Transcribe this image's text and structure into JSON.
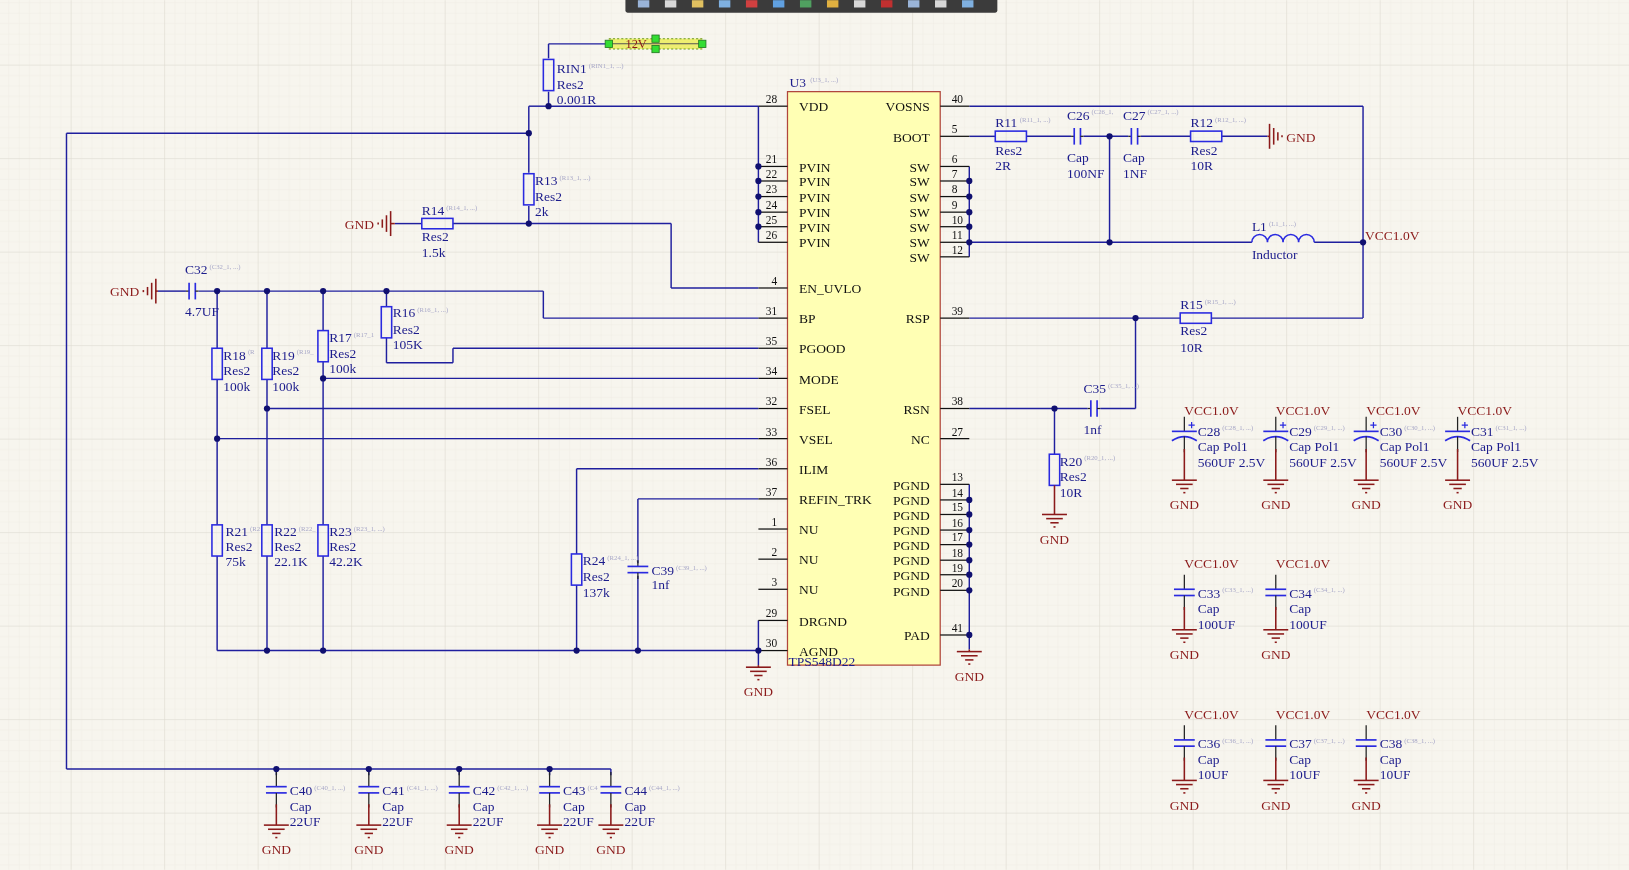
{
  "net_label": {
    "text": "12V",
    "selected": true
  },
  "chip": {
    "designator": "U3",
    "hint": "(U3_1, ...)",
    "part": "TPS548D22",
    "left_pins": [
      {
        "number": "28",
        "name": "VDD"
      },
      {
        "number": "21",
        "name": "PVIN"
      },
      {
        "number": "22",
        "name": "PVIN"
      },
      {
        "number": "23",
        "name": "PVIN"
      },
      {
        "number": "24",
        "name": "PVIN"
      },
      {
        "number": "25",
        "name": "PVIN"
      },
      {
        "number": "26",
        "name": "PVIN"
      },
      {
        "number": "4",
        "name": "EN_UVLO"
      },
      {
        "number": "31",
        "name": "BP"
      },
      {
        "number": "35",
        "name": "PGOOD"
      },
      {
        "number": "34",
        "name": "MODE"
      },
      {
        "number": "32",
        "name": "FSEL"
      },
      {
        "number": "33",
        "name": "VSEL"
      },
      {
        "number": "36",
        "name": "ILIM"
      },
      {
        "number": "37",
        "name": "REFIN_TRK"
      },
      {
        "number": "1",
        "name": "NU"
      },
      {
        "number": "2",
        "name": "NU"
      },
      {
        "number": "3",
        "name": "NU"
      },
      {
        "number": "29",
        "name": "DRGND"
      },
      {
        "number": "30",
        "name": "AGND"
      }
    ],
    "right_pins": [
      {
        "number": "40",
        "name": "VOSNS"
      },
      {
        "number": "5",
        "name": "BOOT"
      },
      {
        "number": "6",
        "name": "SW"
      },
      {
        "number": "7",
        "name": "SW"
      },
      {
        "number": "8",
        "name": "SW"
      },
      {
        "number": "9",
        "name": "SW"
      },
      {
        "number": "10",
        "name": "SW"
      },
      {
        "number": "11",
        "name": "SW"
      },
      {
        "number": "12",
        "name": "SW"
      },
      {
        "number": "39",
        "name": "RSP"
      },
      {
        "number": "38",
        "name": "RSN"
      },
      {
        "number": "27",
        "name": "NC"
      },
      {
        "number": "13",
        "name": "PGND"
      },
      {
        "number": "14",
        "name": "PGND"
      },
      {
        "number": "15",
        "name": "PGND"
      },
      {
        "number": "16",
        "name": "PGND"
      },
      {
        "number": "17",
        "name": "PGND"
      },
      {
        "number": "18",
        "name": "PGND"
      },
      {
        "number": "19",
        "name": "PGND"
      },
      {
        "number": "20",
        "name": "PGND"
      },
      {
        "number": "41",
        "name": "PAD"
      }
    ]
  },
  "components": [
    {
      "kind": "resistor",
      "designator": "RIN1",
      "hint": "(RIN1_1, ...)",
      "comment": "Res2",
      "value": "0.001R"
    },
    {
      "kind": "resistor",
      "designator": "R11",
      "hint": "(R11_1, ...)",
      "comment": "Res2",
      "value": "2R"
    },
    {
      "kind": "capacitor",
      "designator": "C26",
      "hint": "(C26_1,",
      "comment": "Cap",
      "value": "100NF"
    },
    {
      "kind": "capacitor",
      "designator": "C27",
      "hint": "(C27_1, ...)",
      "comment": "Cap",
      "value": "1NF"
    },
    {
      "kind": "resistor",
      "designator": "R12",
      "hint": "(R12_1, ...)",
      "comment": "Res2",
      "value": "10R"
    },
    {
      "kind": "resistor",
      "designator": "R13",
      "hint": "(R13_1, ...)",
      "comment": "Res2",
      "value": "2k"
    },
    {
      "kind": "resistor",
      "designator": "R14",
      "hint": "(R14_1, ...)",
      "comment": "Res2",
      "value": "1.5k"
    },
    {
      "kind": "inductor",
      "designator": "L1",
      "hint": "(L1_1, ...)",
      "comment": "Inductor"
    },
    {
      "kind": "capacitor",
      "designator": "C32",
      "hint": "(C32_1, ...)",
      "value": "4.7UF"
    },
    {
      "kind": "resistor",
      "designator": "R16",
      "hint": "(R16_1, ...)",
      "comment": "Res2",
      "value": "105K"
    },
    {
      "kind": "resistor",
      "designator": "R15",
      "hint": "(R15_1, ...)",
      "comment": "Res2",
      "value": "10R"
    },
    {
      "kind": "resistor",
      "designator": "R17",
      "hint": "(R17_1",
      "comment": "Res2",
      "value": "100k"
    },
    {
      "kind": "resistor",
      "designator": "R18",
      "hint": "(R",
      "comment": "Res2",
      "value": "100k"
    },
    {
      "kind": "resistor",
      "designator": "R19",
      "hint": "(R19_",
      "comment": "Res2",
      "value": "100k"
    },
    {
      "kind": "capacitor",
      "designator": "C35",
      "hint": "(C35_1, ...)",
      "value": "1nf"
    },
    {
      "kind": "resistor",
      "designator": "R20",
      "hint": "(R20_1, ...)",
      "comment": "Res2",
      "value": "10R"
    },
    {
      "kind": "polarized_capacitor",
      "designator": "C28",
      "hint": "(C28_1, ...)",
      "comment": "Cap Pol1",
      "value": "560UF 2.5V"
    },
    {
      "kind": "polarized_capacitor",
      "designator": "C29",
      "hint": "(C29_1, ...)",
      "comment": "Cap Pol1",
      "value": "560UF 2.5V"
    },
    {
      "kind": "polarized_capacitor",
      "designator": "C30",
      "hint": "(C30_1, ...)",
      "comment": "Cap Pol1",
      "value": "560UF 2.5V"
    },
    {
      "kind": "polarized_capacitor",
      "designator": "C31",
      "hint": "(C31_1, ...)",
      "comment": "Cap Pol1",
      "value": "560UF 2.5V"
    },
    {
      "kind": "resistor",
      "designator": "R21",
      "hint": "(R2",
      "comment": "Res2",
      "value": "75k"
    },
    {
      "kind": "resistor",
      "designator": "R22",
      "hint": "(R22_",
      "comment": "Res2",
      "value": "22.1K"
    },
    {
      "kind": "resistor",
      "designator": "R23",
      "hint": "(R23_1, ...)",
      "comment": "Res2",
      "value": "42.2K"
    },
    {
      "kind": "resistor",
      "designator": "R24",
      "hint": "(R24_1, ...)",
      "comment": "Res2",
      "value": "137k"
    },
    {
      "kind": "capacitor",
      "designator": "C39",
      "hint": "(C39_1, ...)",
      "value": "1nf"
    },
    {
      "kind": "capacitor",
      "designator": "C33",
      "hint": "(C33_1, ...)",
      "comment": "Cap",
      "value": "100UF"
    },
    {
      "kind": "capacitor",
      "designator": "C34",
      "hint": "(C34_1, ...)",
      "comment": "Cap",
      "value": "100UF"
    },
    {
      "kind": "capacitor",
      "designator": "C36",
      "hint": "(C36_1, ...)",
      "comment": "Cap",
      "value": "10UF"
    },
    {
      "kind": "capacitor",
      "designator": "C37",
      "hint": "(C37_1, ...)",
      "comment": "Cap",
      "value": "10UF"
    },
    {
      "kind": "capacitor",
      "designator": "C38",
      "hint": "(C38_1, ...)",
      "comment": "Cap",
      "value": "10UF"
    },
    {
      "kind": "capacitor",
      "designator": "C40",
      "hint": "(C40_1, ...)",
      "comment": "Cap",
      "value": "22UF"
    },
    {
      "kind": "capacitor",
      "designator": "C41",
      "hint": "(C41_1, ...)",
      "comment": "Cap",
      "value": "22UF"
    },
    {
      "kind": "capacitor",
      "designator": "C42",
      "hint": "(C42_1, ...)",
      "comment": "Cap",
      "value": "22UF"
    },
    {
      "kind": "capacitor",
      "designator": "C43",
      "hint": "(C4",
      "comment": "Cap",
      "value": "22UF"
    },
    {
      "kind": "capacitor",
      "designator": "C44",
      "hint": "(C44_1, ...)",
      "comment": "Cap",
      "value": "22UF"
    }
  ],
  "power_ports": [
    {
      "kind": "gnd",
      "label": "GND"
    },
    {
      "kind": "gnd",
      "label": "GND"
    },
    {
      "kind": "gnd",
      "label": "GND"
    },
    {
      "kind": "vcc",
      "label": "VCC1.0V"
    },
    {
      "kind": "vcc",
      "label": "VCC1.0V"
    },
    {
      "kind": "vcc",
      "label": "VCC1.0V"
    },
    {
      "kind": "vcc",
      "label": "VCC1.0V"
    },
    {
      "kind": "vcc",
      "label": "VCC1.0V"
    },
    {
      "kind": "gnd",
      "label": "GND"
    },
    {
      "kind": "gnd",
      "label": "GND"
    },
    {
      "kind": "gnd",
      "label": "GND"
    },
    {
      "kind": "gnd",
      "label": "GND"
    },
    {
      "kind": "gnd",
      "label": "GND"
    },
    {
      "kind": "gnd",
      "label": "GND"
    },
    {
      "kind": "gnd",
      "label": "GND"
    },
    {
      "kind": "vcc",
      "label": "VCC1.0V"
    },
    {
      "kind": "vcc",
      "label": "VCC1.0V"
    },
    {
      "kind": "gnd",
      "label": "GND"
    },
    {
      "kind": "gnd",
      "label": "GND"
    },
    {
      "kind": "vcc",
      "label": "VCC1.0V"
    },
    {
      "kind": "vcc",
      "label": "VCC1.0V"
    },
    {
      "kind": "vcc",
      "label": "VCC1.0V"
    },
    {
      "kind": "gnd",
      "label": "GND"
    },
    {
      "kind": "gnd",
      "label": "GND"
    },
    {
      "kind": "gnd",
      "label": "GND"
    },
    {
      "kind": "gnd",
      "label": "GND"
    },
    {
      "kind": "gnd",
      "label": "GND"
    },
    {
      "kind": "gnd",
      "label": "GND"
    },
    {
      "kind": "gnd",
      "label": "GND"
    },
    {
      "kind": "gnd",
      "label": "GND"
    }
  ]
}
